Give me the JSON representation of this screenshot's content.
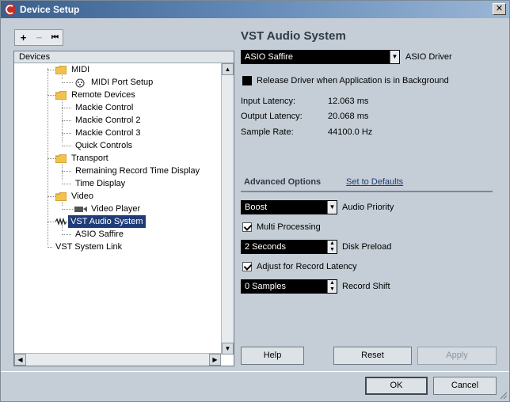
{
  "window": {
    "title": "Device Setup",
    "close_glyph": "✕"
  },
  "toolbar": {
    "add": "+",
    "remove": "−",
    "reset": "⏮"
  },
  "tree": {
    "header": "Devices",
    "items": [
      {
        "label": "MIDI",
        "icon": "folder-icon"
      },
      {
        "label": "MIDI Port Setup",
        "icon": "midi-port-icon"
      },
      {
        "label": "Remote Devices",
        "icon": "folder-icon"
      },
      {
        "label": "Mackie Control"
      },
      {
        "label": "Mackie Control 2"
      },
      {
        "label": "Mackie Control 3"
      },
      {
        "label": "Quick Controls"
      },
      {
        "label": "Transport",
        "icon": "folder-icon"
      },
      {
        "label": "Remaining Record Time Display"
      },
      {
        "label": "Time Display"
      },
      {
        "label": "Video",
        "icon": "folder-icon"
      },
      {
        "label": "Video Player",
        "icon": "video-icon"
      },
      {
        "label": "VST Audio System",
        "icon": "audio-icon",
        "selected": true
      },
      {
        "label": "ASIO Saffire"
      },
      {
        "label": "VST System Link"
      }
    ]
  },
  "panel": {
    "title": "VST Audio System",
    "driver_value": "ASIO Saffire",
    "driver_label": "ASIO Driver",
    "release_label": "Release Driver when Application is in Background",
    "latency": {
      "input_label": "Input Latency:",
      "input_value": "12.063 ms",
      "output_label": "Output Latency:",
      "output_value": "20.068 ms",
      "rate_label": "Sample Rate:",
      "rate_value": "44100.0 Hz"
    },
    "advanced_label": "Advanced Options",
    "defaults_link": "Set to Defaults",
    "priority_value": "Boost",
    "priority_label": "Audio Priority",
    "multi_label": "Multi Processing",
    "preload_value": "2 Seconds",
    "preload_label": "Disk Preload",
    "adjust_label": "Adjust for Record Latency",
    "shift_value": "0 Samples",
    "shift_label": "Record Shift"
  },
  "buttons": {
    "help": "Help",
    "reset": "Reset",
    "apply": "Apply",
    "ok": "OK",
    "cancel": "Cancel"
  }
}
